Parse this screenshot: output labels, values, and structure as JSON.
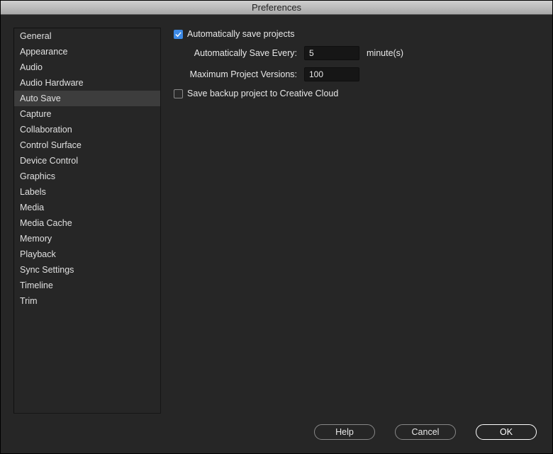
{
  "title": "Preferences",
  "sidebar": {
    "items": [
      {
        "label": "General"
      },
      {
        "label": "Appearance"
      },
      {
        "label": "Audio"
      },
      {
        "label": "Audio Hardware"
      },
      {
        "label": "Auto Save"
      },
      {
        "label": "Capture"
      },
      {
        "label": "Collaboration"
      },
      {
        "label": "Control Surface"
      },
      {
        "label": "Device Control"
      },
      {
        "label": "Graphics"
      },
      {
        "label": "Labels"
      },
      {
        "label": "Media"
      },
      {
        "label": "Media Cache"
      },
      {
        "label": "Memory"
      },
      {
        "label": "Playback"
      },
      {
        "label": "Sync Settings"
      },
      {
        "label": "Timeline"
      },
      {
        "label": "Trim"
      }
    ],
    "selected_index": 4
  },
  "content": {
    "auto_save_checkbox_label": "Automatically save projects",
    "auto_save_checked": true,
    "save_every_label": "Automatically Save Every:",
    "save_every_value": "5",
    "save_every_suffix": "minute(s)",
    "max_versions_label": "Maximum Project Versions:",
    "max_versions_value": "100",
    "backup_cc_label": "Save backup project to Creative Cloud",
    "backup_cc_checked": false
  },
  "footer": {
    "help": "Help",
    "cancel": "Cancel",
    "ok": "OK"
  }
}
